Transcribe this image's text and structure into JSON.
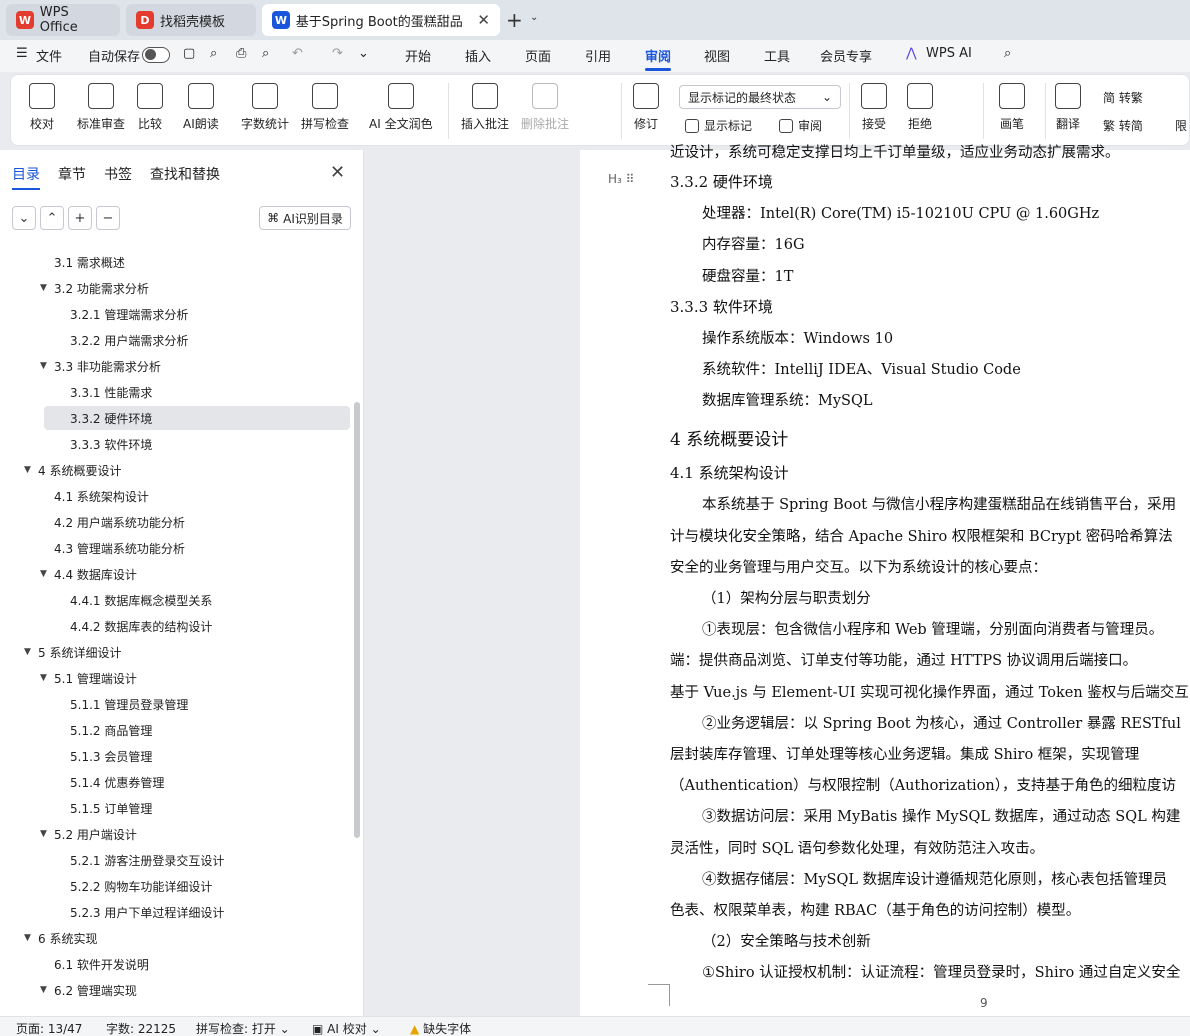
{
  "tabs": [
    {
      "label": "WPS Office",
      "logo": "W",
      "color": "#e33b2e"
    },
    {
      "label": "找稻壳模板",
      "logo": "D",
      "color": "#e33b2e"
    },
    {
      "label": "基于Spring Boot的蛋糕甜品",
      "logo": "W",
      "color": "#1a56db"
    }
  ],
  "menu": {
    "file": "文件",
    "autosave": "自动保存",
    "items": [
      "开始",
      "插入",
      "页面",
      "引用",
      "审阅",
      "视图",
      "工具",
      "会员专享",
      "WPS AI"
    ],
    "active": "审阅"
  },
  "ribbon": {
    "proofread": "校对",
    "standard_review": "标准审查",
    "compare": "比较",
    "ai_read": "AI朗读",
    "word_count": "字数统计",
    "spell_check": "拼写检查",
    "ai_polish": "AI 全文润色",
    "insert_comment": "插入批注",
    "delete_comment": "删除批注",
    "revise": "修订",
    "markup_dropdown": "显示标记的最终状态",
    "show_markup": "显示标记",
    "review": "审阅",
    "accept": "接受",
    "reject": "拒绝",
    "pen": "画笔",
    "translate": "翻译",
    "to_traditional": "简 转繁",
    "to_simplified": "繁 转简",
    "limit": "限"
  },
  "panel": {
    "tabs": [
      "目录",
      "章节",
      "书签",
      "查找和替换"
    ],
    "ai_toc": "AI识别目录",
    "toc": [
      {
        "label": "3.1  需求概述",
        "level": 2,
        "caret": false
      },
      {
        "label": "3.2  功能需求分析",
        "level": 2,
        "caret": true
      },
      {
        "label": "3.2.1  管理端需求分析",
        "level": 3,
        "caret": false
      },
      {
        "label": "3.2.2  用户端需求分析",
        "level": 3,
        "caret": false
      },
      {
        "label": "3.3  非功能需求分析",
        "level": 2,
        "caret": true
      },
      {
        "label": "3.3.1  性能需求",
        "level": 3,
        "caret": false
      },
      {
        "label": "3.3.2  硬件环境",
        "level": 3,
        "caret": false,
        "selected": true
      },
      {
        "label": "3.3.3  软件环境",
        "level": 3,
        "caret": false
      },
      {
        "label": "4  系统概要设计",
        "level": 1,
        "caret": true
      },
      {
        "label": "4.1  系统架构设计",
        "level": 2,
        "caret": false
      },
      {
        "label": "4.2  用户端系统功能分析",
        "level": 2,
        "caret": false
      },
      {
        "label": "4.3  管理端系统功能分析",
        "level": 2,
        "caret": false
      },
      {
        "label": "4.4  数据库设计",
        "level": 2,
        "caret": true
      },
      {
        "label": "4.4.1  数据库概念模型关系",
        "level": 3,
        "caret": false
      },
      {
        "label": "4.4.2  数据库表的结构设计",
        "level": 3,
        "caret": false
      },
      {
        "label": "5  系统详细设计",
        "level": 1,
        "caret": true
      },
      {
        "label": "5.1  管理端设计",
        "level": 2,
        "caret": true
      },
      {
        "label": "5.1.1  管理员登录管理",
        "level": 3,
        "caret": false
      },
      {
        "label": "5.1.2  商品管理",
        "level": 3,
        "caret": false
      },
      {
        "label": "5.1.3  会员管理",
        "level": 3,
        "caret": false
      },
      {
        "label": "5.1.4  优惠券管理",
        "level": 3,
        "caret": false
      },
      {
        "label": "5.1.5  订单管理",
        "level": 3,
        "caret": false
      },
      {
        "label": "5.2  用户端设计",
        "level": 2,
        "caret": true
      },
      {
        "label": "5.2.1  游客注册登录交互设计",
        "level": 3,
        "caret": false
      },
      {
        "label": "5.2.2  购物车功能详细设计",
        "level": 3,
        "caret": false
      },
      {
        "label": "5.2.3  用户下单过程详细设计",
        "level": 3,
        "caret": false
      },
      {
        "label": "6  系统实现",
        "level": 1,
        "caret": true
      },
      {
        "label": "6.1  软件开发说明",
        "level": 2,
        "caret": false
      },
      {
        "label": "6.2  管理端实现",
        "level": 2,
        "caret": true
      }
    ]
  },
  "document": {
    "top_cut": "近设计，系统可稳定支撑日均上千订单量级，适应业务动态扩展需求。",
    "h_332": "3.3.2  硬件环境",
    "cpu": "处理器：Intel(R) Core(TM) i5-10210U CPU @ 1.60GHz",
    "ram": "内存容量：16G",
    "disk": "硬盘容量：1T",
    "h_333": "3.3.3  软件环境",
    "os": "操作系统版本：Windows 10",
    "software": "系统软件：IntelliJ IDEA、Visual Studio Code",
    "dbms": "数据库管理系统：MySQL",
    "h_4": "4  系统概要设计",
    "h_41": "4.1  系统架构设计",
    "p1": "本系统基于 Spring Boot 与微信小程序构建蛋糕甜品在线销售平台，采用",
    "p2": "计与模块化安全策略，结合 Apache Shiro 权限框架和 BCrypt 密码哈希算法",
    "p3": "安全的业务管理与用户交互。以下为系统设计的核心要点：",
    "p4": "（1）架构分层与职责划分",
    "p5": "①表现层：包含微信小程序和 Web 管理端，分别面向消费者与管理员。",
    "p6": "端：提供商品浏览、订单支付等功能，通过 HTTPS 协议调用后端接口。",
    "p7": "基于 Vue.js 与 Element-UI 实现可视化操作界面，通过 Token 鉴权与后端交互",
    "p8": "②业务逻辑层：以 Spring Boot 为核心，通过 Controller 暴露 RESTful",
    "p9": "层封装库存管理、订单处理等核心业务逻辑。集成 Shiro 框架，实现管理",
    "p10": "（Authentication）与权限控制（Authorization），支持基于角色的细粒度访",
    "p11": "③数据访问层：采用 MyBatis 操作 MySQL 数据库，通过动态 SQL 构建",
    "p12": "灵活性，同时 SQL 语句参数化处理，有效防范注入攻击。",
    "p13": "④数据存储层：MySQL 数据库设计遵循规范化原则，核心表包括管理员",
    "p14": "色表、权限菜单表，构建 RBAC（基于角色的访问控制）模型。",
    "p15": "（2）安全策略与技术创新",
    "p16": "①Shiro 认证授权机制：认证流程：管理员登录时，Shiro 通过自定义安全",
    "page_number": "9"
  },
  "status": {
    "page": "页面: 13/47",
    "words": "字数: 22125",
    "spell": "拼写检查: 打开",
    "ai_proof": "AI 校对",
    "missing_font": "缺失字体"
  }
}
